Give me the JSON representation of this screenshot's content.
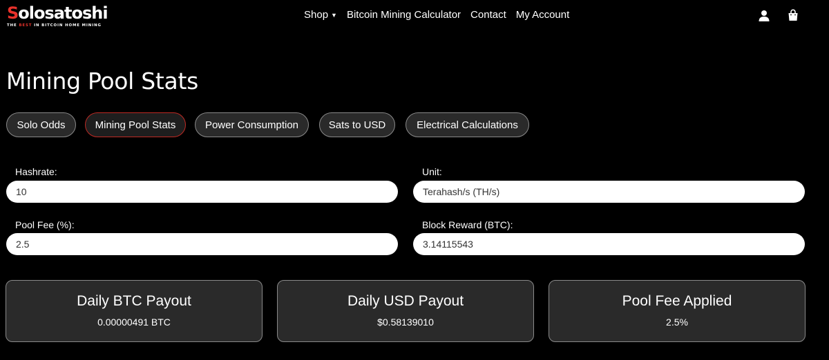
{
  "brand": {
    "name_first": "S",
    "name_rest": "olosatoshi",
    "tagline_pre": "THE ",
    "tagline_highlight": "BEST",
    "tagline_post": " IN BITCOIN HOME MINING"
  },
  "nav": {
    "items": [
      {
        "label": "Shop",
        "has_dropdown": true
      },
      {
        "label": "Bitcoin Mining Calculator"
      },
      {
        "label": "Contact"
      },
      {
        "label": "My Account"
      }
    ]
  },
  "header_icons": [
    "user-icon",
    "shopping-bag-icon"
  ],
  "page": {
    "title": "Mining Pool Stats"
  },
  "tabs": [
    {
      "label": "Solo Odds",
      "active": false
    },
    {
      "label": "Mining Pool Stats",
      "active": true
    },
    {
      "label": "Power Consumption",
      "active": false
    },
    {
      "label": "Sats to USD",
      "active": false
    },
    {
      "label": "Electrical Calculations",
      "active": false
    }
  ],
  "form": {
    "hashrate": {
      "label": "Hashrate:",
      "value": "10"
    },
    "unit": {
      "label": "Unit:",
      "value": "Terahash/s (TH/s)"
    },
    "pool_fee": {
      "label": "Pool Fee (%):",
      "value": "2.5"
    },
    "block_reward": {
      "label": "Block Reward (BTC):",
      "value": "3.14115543"
    }
  },
  "results": [
    {
      "title": "Daily BTC Payout",
      "value": "0.00000491 BTC"
    },
    {
      "title": "Daily USD Payout",
      "value": "$0.58139010"
    },
    {
      "title": "Pool Fee Applied",
      "value": "2.5%"
    }
  ],
  "colors": {
    "background": "#000000",
    "accent": "#e8322b",
    "card_bg": "#2a2a2a",
    "active_tab_border": "#c02a24"
  }
}
